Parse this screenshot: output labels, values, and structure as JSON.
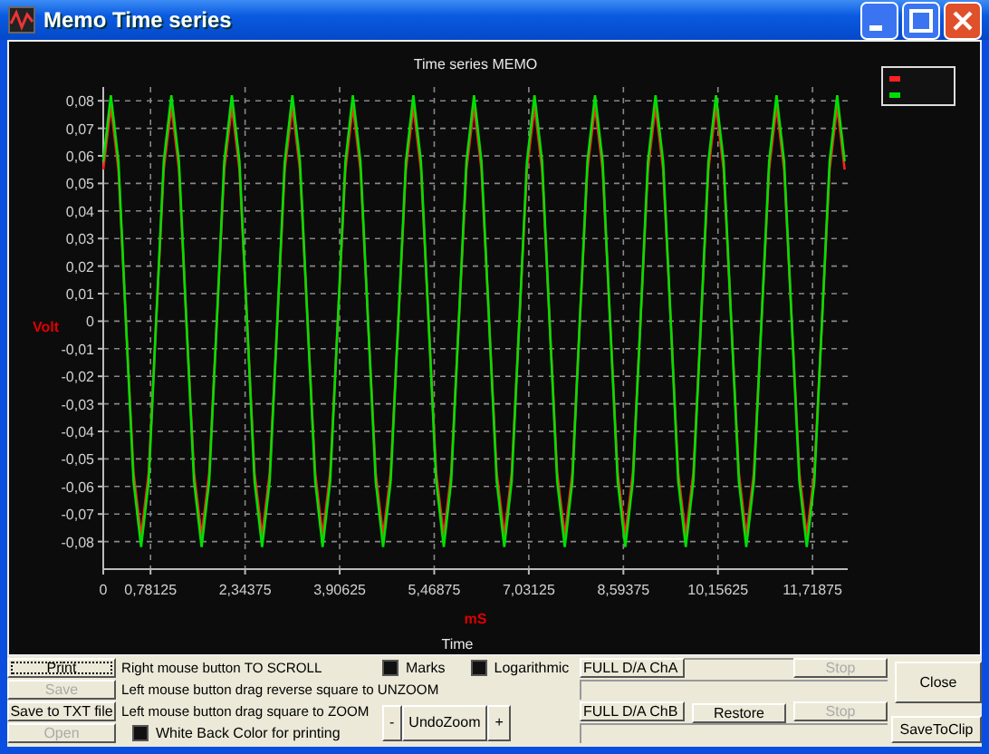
{
  "window": {
    "title": "Memo Time series"
  },
  "graph": {
    "x_unit": "mS",
    "chart_data": {
      "type": "line",
      "title": "Time series MEMO",
      "xlabel": "Time",
      "ylabel": "Volt",
      "x": [
        0,
        0.125,
        0.25,
        0.375,
        0.5,
        0.625,
        0.75,
        0.875,
        1,
        1.125,
        1.25,
        1.375,
        1.5,
        1.625,
        1.75,
        1.875,
        2,
        2.125,
        2.25,
        2.375,
        2.5,
        2.625,
        2.75,
        2.875,
        3,
        3.125,
        3.25,
        3.375,
        3.5,
        3.625,
        3.75,
        3.875,
        4,
        4.125,
        4.25,
        4.375,
        4.5,
        4.625,
        4.75,
        4.875,
        5,
        5.125,
        5.25,
        5.375,
        5.5,
        5.625,
        5.75,
        5.875,
        6,
        6.125,
        6.25,
        6.375,
        6.5,
        6.625,
        6.75,
        6.875,
        7,
        7.125,
        7.25,
        7.375,
        7.5,
        7.625,
        7.75,
        7.875,
        8,
        8.125,
        8.25,
        8.375,
        8.5,
        8.625,
        8.75,
        8.875,
        9,
        9.125,
        9.25,
        9.375,
        9.5,
        9.625,
        9.75,
        9.875,
        10,
        10.125,
        10.25,
        10.375,
        10.5,
        10.625,
        10.75,
        10.875,
        11,
        11.125,
        11.25,
        11.375,
        11.5,
        11.625,
        11.75,
        11.875,
        12,
        12.125,
        12.25
      ],
      "series": [
        {
          "color": "#ff2020",
          "values": [
            0.055,
            0.078,
            0.055,
            0,
            -0.055,
            -0.078,
            -0.055,
            0,
            0.055,
            0.078,
            0.055,
            0,
            -0.055,
            -0.078,
            -0.055,
            0,
            0.055,
            0.078,
            0.055,
            0,
            -0.055,
            -0.078,
            -0.055,
            0,
            0.055,
            0.078,
            0.055,
            0,
            -0.055,
            -0.078,
            -0.055,
            0,
            0.055,
            0.078,
            0.055,
            0,
            -0.055,
            -0.078,
            -0.055,
            0,
            0.055,
            0.078,
            0.055,
            0,
            -0.055,
            -0.078,
            -0.055,
            0,
            0.055,
            0.078,
            0.055,
            0,
            -0.055,
            -0.078,
            -0.055,
            0,
            0.055,
            0.078,
            0.055,
            0,
            -0.055,
            -0.078,
            -0.055,
            0,
            0.055,
            0.078,
            0.055,
            0,
            -0.055,
            -0.078,
            -0.055,
            0,
            0.055,
            0.078,
            0.055,
            0,
            -0.055,
            -0.078,
            -0.055,
            0,
            0.055,
            0.078,
            0.055,
            0,
            -0.055,
            -0.078,
            -0.055,
            0,
            0.055,
            0.078,
            0.055,
            0,
            -0.055,
            -0.078,
            -0.055,
            0,
            0.055,
            0.078,
            0.055
          ]
        },
        {
          "color": "#00e000",
          "values": [
            0.058,
            0.082,
            0.058,
            0,
            -0.058,
            -0.082,
            -0.058,
            0,
            0.058,
            0.082,
            0.058,
            0,
            -0.058,
            -0.082,
            -0.058,
            0,
            0.058,
            0.082,
            0.058,
            0,
            -0.058,
            -0.082,
            -0.058,
            0,
            0.058,
            0.082,
            0.058,
            0,
            -0.058,
            -0.082,
            -0.058,
            0,
            0.058,
            0.082,
            0.058,
            0,
            -0.058,
            -0.082,
            -0.058,
            0,
            0.058,
            0.082,
            0.058,
            0,
            -0.058,
            -0.082,
            -0.058,
            0,
            0.058,
            0.082,
            0.058,
            0,
            -0.058,
            -0.082,
            -0.058,
            0,
            0.058,
            0.082,
            0.058,
            0,
            -0.058,
            -0.082,
            -0.058,
            0,
            0.058,
            0.082,
            0.058,
            0,
            -0.058,
            -0.082,
            -0.058,
            0,
            0.058,
            0.082,
            0.058,
            0,
            -0.058,
            -0.082,
            -0.058,
            0,
            0.058,
            0.082,
            0.058,
            0,
            -0.058,
            -0.082,
            -0.058,
            0,
            0.058,
            0.082,
            0.058,
            0,
            -0.058,
            -0.082,
            -0.058,
            0,
            0.058,
            0.082,
            0.058
          ]
        }
      ],
      "xlim": [
        0,
        12.3
      ],
      "grid": true,
      "ylim": [
        -0.09,
        0.085
      ],
      "xticks": [
        {
          "value": 0,
          "label": "0"
        },
        {
          "value": 0.78125,
          "label": "0,78125"
        },
        {
          "value": 2.34375,
          "label": "2,34375"
        },
        {
          "value": 3.90625,
          "label": "3,90625"
        },
        {
          "value": 5.46875,
          "label": "5,46875"
        },
        {
          "value": 7.03125,
          "label": "7,03125"
        },
        {
          "value": 8.59375,
          "label": "8,59375"
        },
        {
          "value": 10.15625,
          "label": "10,15625"
        },
        {
          "value": 11.71875,
          "label": "11,71875"
        }
      ],
      "yticks": [
        {
          "value": 0.08,
          "label": "0,08"
        },
        {
          "value": 0.07,
          "label": "0,07"
        },
        {
          "value": 0.06,
          "label": "0,06"
        },
        {
          "value": 0.05,
          "label": "0,05"
        },
        {
          "value": 0.04,
          "label": "0,04"
        },
        {
          "value": 0.03,
          "label": "0,03"
        },
        {
          "value": 0.02,
          "label": "0,02"
        },
        {
          "value": 0.01,
          "label": "0,01"
        },
        {
          "value": 0,
          "label": "0"
        },
        {
          "value": -0.01,
          "label": "-0,01"
        },
        {
          "value": -0.02,
          "label": "-0,02"
        },
        {
          "value": -0.03,
          "label": "-0,03"
        },
        {
          "value": -0.04,
          "label": "-0,04"
        },
        {
          "value": -0.05,
          "label": "-0,05"
        },
        {
          "value": -0.06,
          "label": "-0,06"
        },
        {
          "value": -0.07,
          "label": "-0,07"
        },
        {
          "value": -0.08,
          "label": "-0,08"
        }
      ]
    }
  },
  "left_buttons": [
    {
      "label": "Print",
      "disabled": false,
      "focused": true
    },
    {
      "label": "Save",
      "disabled": true,
      "focused": false
    },
    {
      "label": "Save to TXT file",
      "disabled": false,
      "focused": false
    },
    {
      "label": "Open",
      "disabled": true,
      "focused": false
    }
  ],
  "hints": [
    "Right mouse button TO SCROLL",
    "Left mouse button drag reverse square to UNZOOM",
    "Left mouse button drag square to ZOOM"
  ],
  "checkboxes": [
    {
      "label": "Marks",
      "checked": true
    },
    {
      "label": "Logarithmic",
      "checked": true
    },
    {
      "label": "White Back Color for printing",
      "checked": true
    }
  ],
  "zoom_buttons": [
    "-",
    "UndoZoom",
    "+"
  ],
  "channels": [
    {
      "label": "FULL D/A ChA",
      "stop": "Stop",
      "stop_disabled": true
    },
    {
      "label": "FULL D/A ChB",
      "stop": "Stop",
      "stop_disabled": true
    }
  ],
  "restore": "Restore",
  "close": "Close",
  "save_to_clip": "SaveToClip"
}
